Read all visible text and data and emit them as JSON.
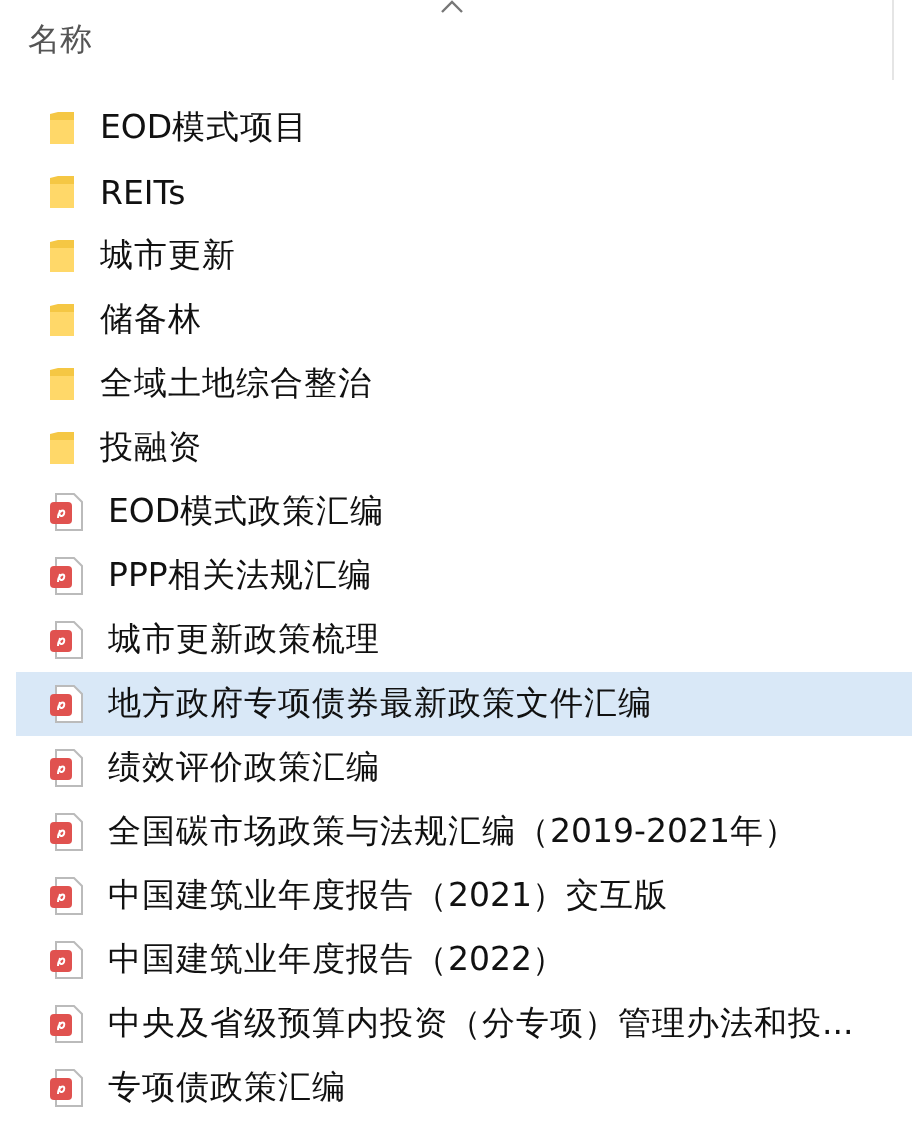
{
  "header": {
    "column": "名称"
  },
  "files": [
    {
      "kind": "folder",
      "name": "EOD模式项目",
      "selected": false
    },
    {
      "kind": "folder",
      "name": "REITs",
      "selected": false
    },
    {
      "kind": "folder",
      "name": "城市更新",
      "selected": false
    },
    {
      "kind": "folder",
      "name": "储备林",
      "selected": false
    },
    {
      "kind": "folder",
      "name": "全域土地综合整治",
      "selected": false
    },
    {
      "kind": "folder",
      "name": "投融资",
      "selected": false
    },
    {
      "kind": "pdf",
      "name": "EOD模式政策汇编",
      "selected": false
    },
    {
      "kind": "pdf",
      "name": "PPP相关法规汇编",
      "selected": false
    },
    {
      "kind": "pdf",
      "name": "城市更新政策梳理",
      "selected": false
    },
    {
      "kind": "pdf",
      "name": "地方政府专项债券最新政策文件汇编",
      "selected": true
    },
    {
      "kind": "pdf",
      "name": "绩效评价政策汇编",
      "selected": false
    },
    {
      "kind": "pdf",
      "name": "全国碳市场政策与法规汇编（2019-2021年）",
      "selected": false
    },
    {
      "kind": "pdf",
      "name": "中国建筑业年度报告（2021）交互版",
      "selected": false
    },
    {
      "kind": "pdf",
      "name": "中国建筑业年度报告（2022）",
      "selected": false
    },
    {
      "kind": "pdf",
      "name": "中央及省级预算内投资（分专项）管理办法和投...",
      "selected": false
    },
    {
      "kind": "pdf",
      "name": "专项债政策汇编",
      "selected": false
    }
  ]
}
